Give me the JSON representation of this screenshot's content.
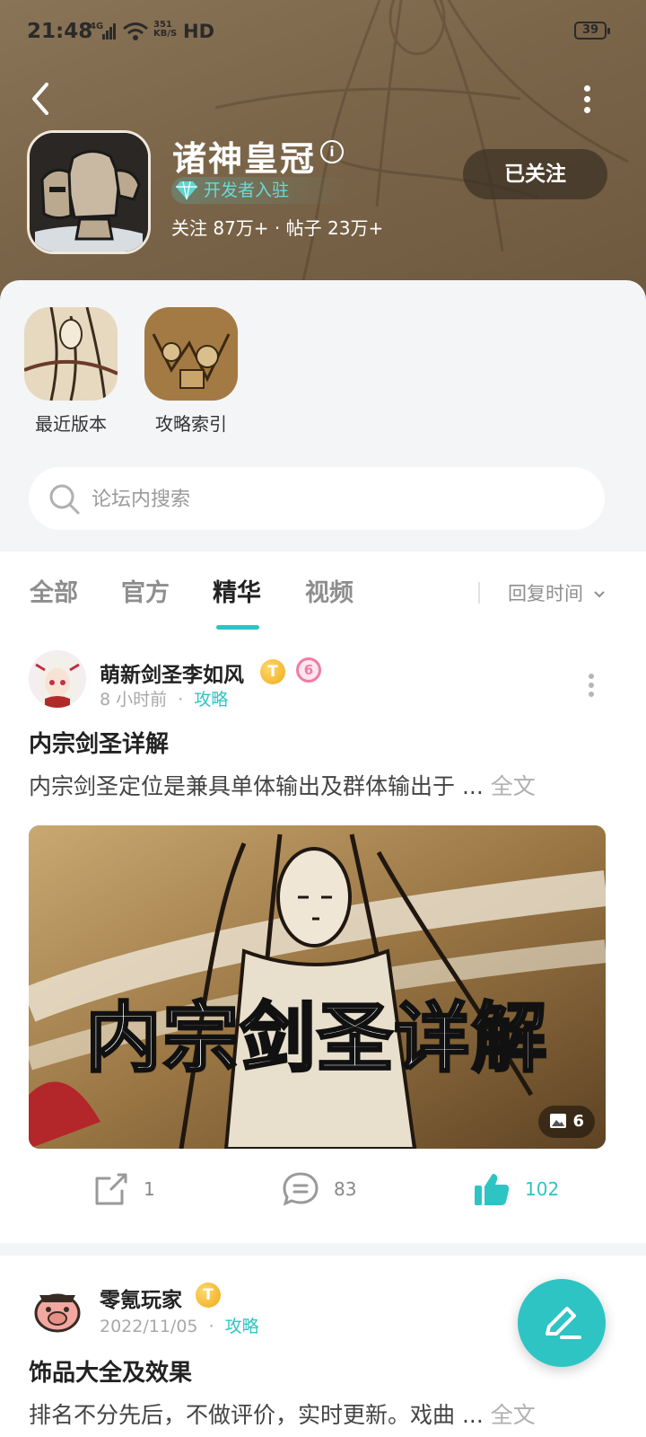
{
  "status_bar": {
    "time": "21:48",
    "network": "4G",
    "speed_value": "351",
    "speed_unit": "KB/S",
    "hd": "HD",
    "battery": "39"
  },
  "app": {
    "title": "诸神皇冠",
    "dev_badge": "开发者入驻",
    "stats": "关注 87万+ · 帖子 23万+",
    "follow_label": "已关注"
  },
  "shortcuts": [
    {
      "label": "最近版本"
    },
    {
      "label": "攻略索引"
    }
  ],
  "search": {
    "placeholder": "论坛内搜索"
  },
  "tabs": [
    {
      "label": "全部"
    },
    {
      "label": "官方"
    },
    {
      "label": "精华"
    },
    {
      "label": "视频"
    }
  ],
  "sort_label": "回复时间",
  "posts": [
    {
      "author": "萌新剑圣李如风",
      "badge_level": "T",
      "badge_6": "6",
      "time": "8 小时前",
      "category": "攻略",
      "title": "内宗剑圣详解",
      "excerpt": "内宗剑圣定位是兼具单体输出及群体输出于 ...",
      "full_label": "全文",
      "image_caption": "内宗剑圣详解",
      "image_count": "6",
      "shares": "1",
      "comments": "83",
      "likes": "102"
    },
    {
      "author": "零氪玩家",
      "badge_level": "T",
      "time": "2022/11/05",
      "category": "攻略",
      "title": "饰品大全及效果",
      "excerpt": "排名不分先后，不做评价，实时更新。戏曲 ...",
      "full_label": "全文"
    }
  ],
  "accent_color": "#2ec4c4"
}
